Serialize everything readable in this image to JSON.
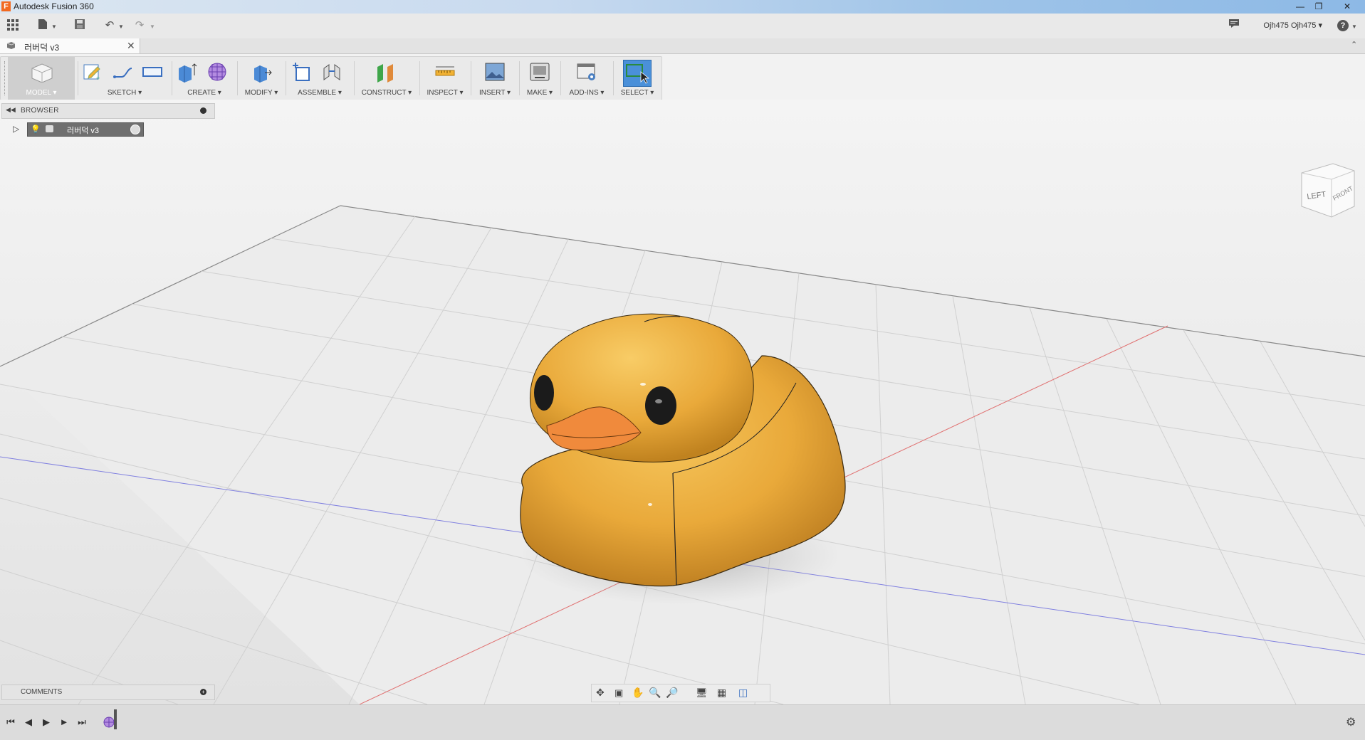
{
  "window": {
    "title": "Autodesk Fusion 360",
    "logo_letter": "F",
    "buttons": [
      "minimize",
      "restore",
      "close"
    ]
  },
  "quick_access": {
    "user": "Ojh475 Ojh475 ▾",
    "help": "?"
  },
  "document_tab": {
    "label": "러버덕 v3",
    "close": "✕"
  },
  "toolbar": {
    "groups": [
      {
        "label": "MODEL ▾"
      },
      {
        "label": "SKETCH ▾"
      },
      {
        "label": "CREATE ▾"
      },
      {
        "label": "MODIFY ▾"
      },
      {
        "label": "ASSEMBLE ▾"
      },
      {
        "label": "CONSTRUCT ▾"
      },
      {
        "label": "INSPECT ▾"
      },
      {
        "label": "INSERT ▾"
      },
      {
        "label": "MAKE ▾"
      },
      {
        "label": "ADD-INS ▾"
      },
      {
        "label": "SELECT ▾"
      }
    ]
  },
  "browser": {
    "title": "BROWSER",
    "root_item": "러버덕 v3"
  },
  "viewcube": {
    "left": "LEFT",
    "front": "FRONT"
  },
  "comments": {
    "title": "COMMENTS"
  },
  "colors": {
    "duck_body": "#e9a93a",
    "duck_beak": "#f08a3c",
    "selection_blue": "#4a90d9",
    "axis_red": "#e06060",
    "axis_blue": "#7070e0"
  }
}
